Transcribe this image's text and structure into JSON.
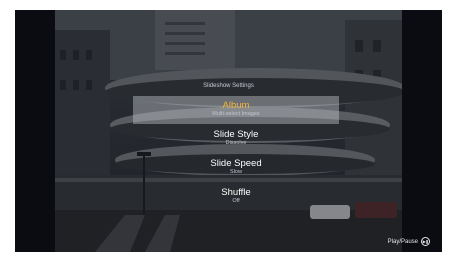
{
  "menu": {
    "title": "Slideshow Settings",
    "items": [
      {
        "label": "Album",
        "sub": "Multi-select Images",
        "selected": true
      },
      {
        "label": "Slide Style",
        "sub": "Dissolve",
        "selected": false
      },
      {
        "label": "Slide Speed",
        "sub": "Slow",
        "selected": false
      },
      {
        "label": "Shuffle",
        "sub": "Off",
        "selected": false
      }
    ]
  },
  "hint": {
    "label": "Play/Pause",
    "icon": "play-pause-icon"
  },
  "colors": {
    "accent": "#f3b43a",
    "background": "#0b0d12"
  }
}
